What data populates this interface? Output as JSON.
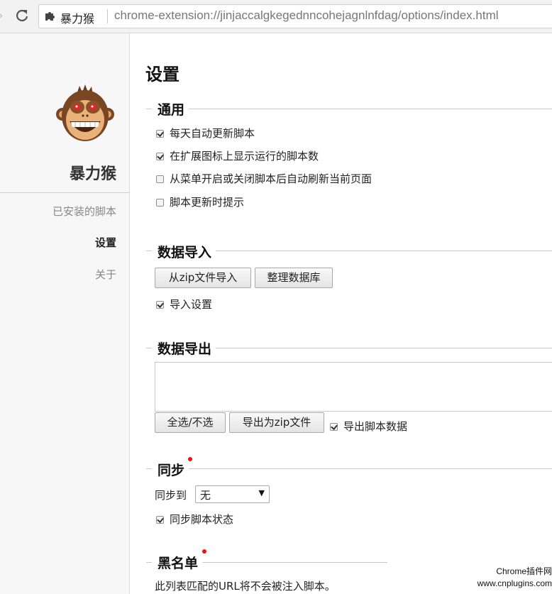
{
  "browser": {
    "site_name": "暴力猴",
    "url": "chrome-extension://jinjaccalgkegednncohejagnlnfdag/options/index.html"
  },
  "sidebar": {
    "app_name": "暴力猴",
    "items": [
      {
        "label": "已安装的脚本",
        "active": false
      },
      {
        "label": "设置",
        "active": true
      },
      {
        "label": "关于",
        "active": false
      }
    ]
  },
  "main": {
    "title": "设置",
    "general": {
      "title": "通用",
      "options": [
        {
          "label": "每天自动更新脚本",
          "checked": true
        },
        {
          "label": "在扩展图标上显示运行的脚本数",
          "checked": true
        },
        {
          "label": "从菜单开启或关闭脚本后自动刷新当前页面",
          "checked": false
        },
        {
          "label": "脚本更新时提示",
          "checked": false
        }
      ]
    },
    "import": {
      "title": "数据导入",
      "import_zip_label": "从zip文件导入",
      "vacuum_label": "整理数据库",
      "import_settings_label": "导入设置",
      "import_settings_checked": true
    },
    "export": {
      "title": "数据导出",
      "select_all_label": "全选/不选",
      "export_zip_label": "导出为zip文件",
      "export_data_label": "导出脚本数据",
      "export_data_checked": true
    },
    "sync": {
      "title": "同步",
      "sync_to_label": "同步到",
      "sync_value": "无",
      "sync_status_label": "同步脚本状态",
      "sync_status_checked": true
    },
    "blacklist": {
      "title": "黑名单",
      "description": "此列表匹配的URL将不会被注入脚本。"
    }
  },
  "watermark": {
    "line1": "Chrome插件网",
    "line2": "www.cnplugins.com"
  },
  "colors": {
    "badge_dot": "#e11111",
    "sidebar_bg": "#f7f7f7"
  }
}
